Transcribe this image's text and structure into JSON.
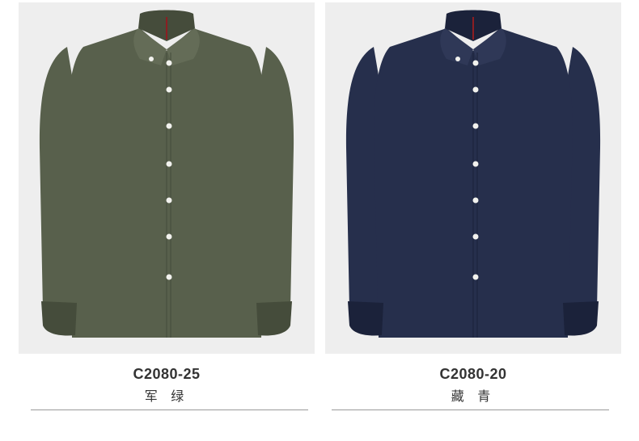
{
  "products": [
    {
      "code": "C2080-25",
      "color_name": "军 绿",
      "shirt_color": "#58604c",
      "shadow_color": "#454c3b",
      "highlight_color": "#646c57"
    },
    {
      "code": "C2080-20",
      "color_name": "藏 青",
      "shirt_color": "#262f4c",
      "shadow_color": "#1b223a",
      "highlight_color": "#2f3857"
    }
  ]
}
